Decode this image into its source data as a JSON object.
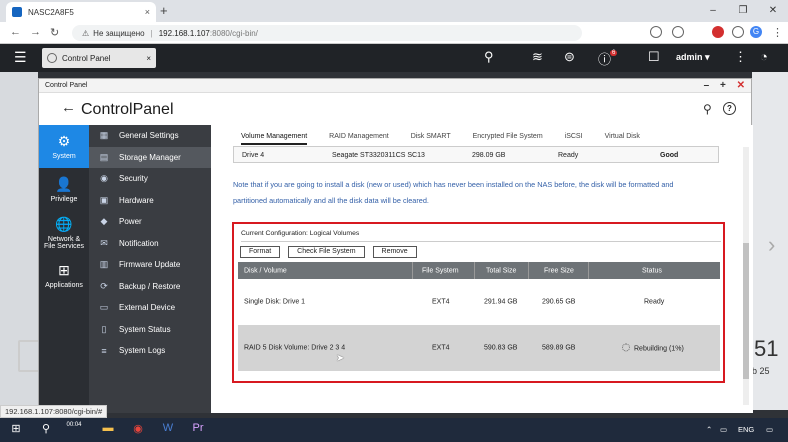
{
  "browser": {
    "tab_title": "NASC2A8F5",
    "tab_close": "×",
    "new_tab": "+",
    "window_controls": [
      "–",
      "❐",
      "✕"
    ],
    "nav": [
      "←",
      "→",
      "↻"
    ],
    "security_label": "Не защищено",
    "url_host": "192.168.1.107",
    "url_path": ":8080/cgi-bin/",
    "profile_initial": "G"
  },
  "qnap_bar": {
    "menu_icon": "☰",
    "app_tab_label": "Control Panel",
    "app_tab_close": "×",
    "user": "admin ▾",
    "notification_count": "6"
  },
  "window": {
    "title": "Control Panel",
    "controls": [
      "–",
      "+",
      "✕"
    ],
    "back": "←",
    "brand_a": "Control",
    "brand_b": "Panel",
    "help": "?"
  },
  "icon_nav": [
    {
      "label": "System",
      "glyph": "⚙"
    },
    {
      "label": "Privilege",
      "glyph": "👤"
    },
    {
      "label": "Network &\nFile Services",
      "glyph": "🌐"
    },
    {
      "label": "Applications",
      "glyph": "⊞"
    }
  ],
  "menu": [
    {
      "label": "General Settings",
      "glyph": "▦"
    },
    {
      "label": "Storage Manager",
      "glyph": "▤"
    },
    {
      "label": "Security",
      "glyph": "◉"
    },
    {
      "label": "Hardware",
      "glyph": "▣"
    },
    {
      "label": "Power",
      "glyph": "◆"
    },
    {
      "label": "Notification",
      "glyph": "✉"
    },
    {
      "label": "Firmware Update",
      "glyph": "▥"
    },
    {
      "label": "Backup / Restore",
      "glyph": "⟳"
    },
    {
      "label": "External Device",
      "glyph": "▭"
    },
    {
      "label": "System Status",
      "glyph": "▯"
    },
    {
      "label": "System Logs",
      "glyph": "≡"
    }
  ],
  "subtabs": [
    "Volume Management",
    "RAID Management",
    "Disk SMART",
    "Encrypted File System",
    "iSCSI",
    "Virtual Disk"
  ],
  "drive_row": {
    "drive": "Drive 4",
    "model": "Seagate ST3320311CS SC13",
    "size": "298.09 GB",
    "state": "Ready",
    "health": "Good"
  },
  "note": "Note that if you are going to install a disk (new or used) which has never been installed on the NAS before, the disk will be formatted and partitioned automatically and all the disk data will be cleared.",
  "config": {
    "heading": "Current Configuration: Logical Volumes",
    "buttons": [
      "Format",
      "Check File System",
      "Remove"
    ],
    "columns": [
      "Disk / Volume",
      "File System",
      "Total Size",
      "Free Size",
      "Status"
    ],
    "rows": [
      {
        "volume": "Single Disk: Drive 1",
        "fs": "EXT4",
        "total": "291.94 GB",
        "free": "290.65 GB",
        "status": "Ready"
      },
      {
        "volume": "RAID 5 Disk Volume: Drive 2 3 4",
        "fs": "EXT4",
        "total": "590.83 GB",
        "free": "589.89 GB",
        "status": "Rebuilding (1%)"
      }
    ]
  },
  "desktop": {
    "clock": "51",
    "date": "b 25"
  },
  "status_url": "192.168.1.107:8080/cgi-bin/#",
  "taskbar": {
    "lang": "ENG",
    "time_badge": "00:04"
  }
}
